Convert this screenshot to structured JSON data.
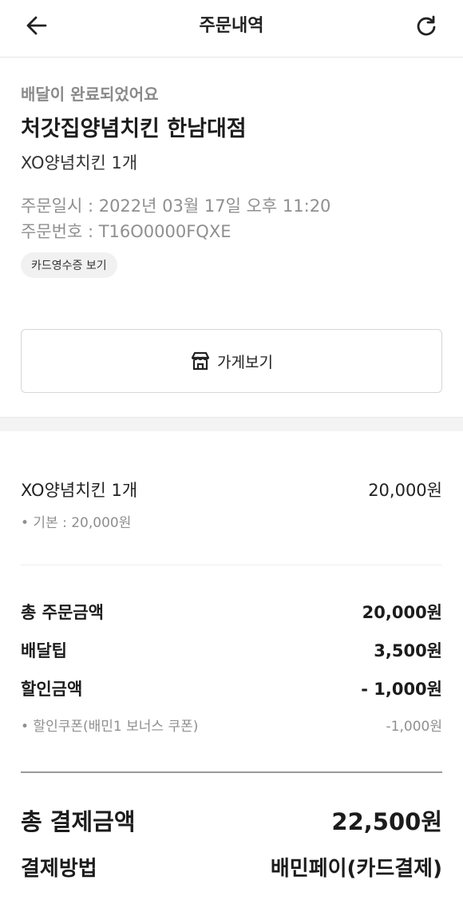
{
  "header": {
    "title": "주문내역",
    "back_icon": "arrow-left-icon",
    "refresh_icon": "refresh-icon"
  },
  "order": {
    "status": "배달이 완료되었어요",
    "store_name": "처갓집양념치킨 한남대점",
    "menu_summary": "XO양념치킨 1개",
    "order_datetime": "주문일시 : 2022년 03월 17일 오후 11:20",
    "order_number": "주문번호 : T16O0000FQXE",
    "receipt_label": "카드영수증 보기",
    "store_button_label": "가게보기",
    "store_icon": "store-icon"
  },
  "items": [
    {
      "name": "XO양념치킨 1개",
      "price": "20,000원",
      "option": "• 기본 : 20,000원"
    }
  ],
  "summary": {
    "total_order_label": "총 주문금액",
    "total_order_value": "20,000원",
    "delivery_tip_label": "배달팁",
    "delivery_tip_value": "3,500원",
    "discount_label": "할인금액",
    "discount_value": "- 1,000원",
    "coupon_label": "• 할인쿠폰(배민1 보너스 쿠폰)",
    "coupon_value": "-1,000원"
  },
  "payment": {
    "total_label": "총 결제금액",
    "total_value": "22,500원",
    "method_label": "결제방법",
    "method_value": "배민페이(카드결제)"
  }
}
